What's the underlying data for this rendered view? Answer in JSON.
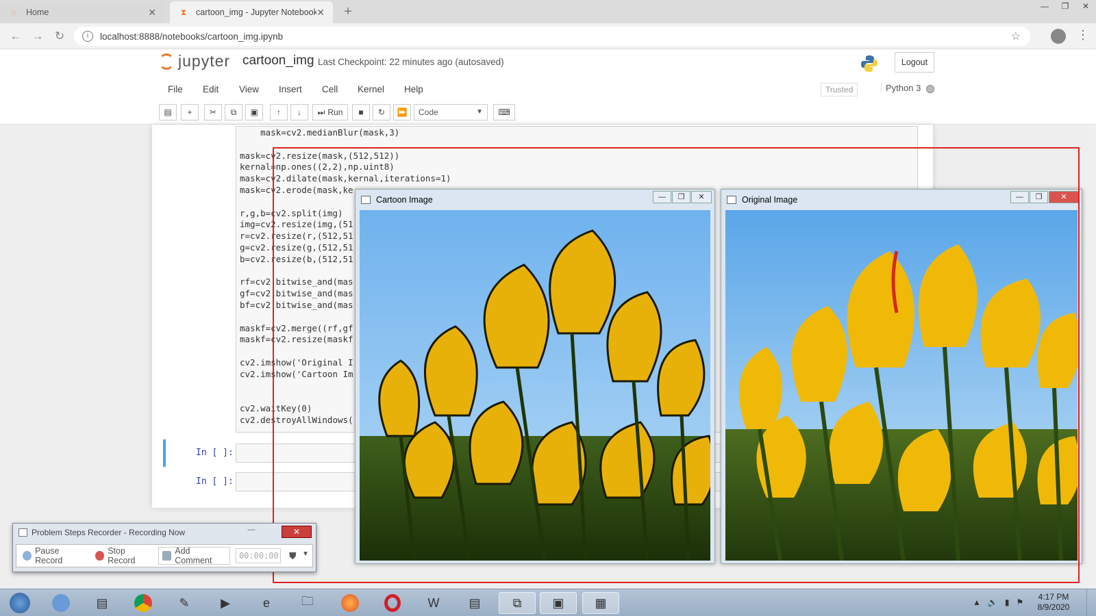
{
  "browser": {
    "tabs": [
      {
        "label": "Home",
        "active": false
      },
      {
        "label": "cartoon_img - Jupyter Notebook",
        "active": true
      }
    ],
    "url": "localhost:8888/notebooks/cartoon_img.ipynb"
  },
  "jupyter": {
    "logo_text": "jupyter",
    "notebook_name": "cartoon_img",
    "checkpoint": "Last Checkpoint: 22 minutes ago  (autosaved)",
    "logout_label": "Logout",
    "menu": [
      "File",
      "Edit",
      "View",
      "Insert",
      "Cell",
      "Kernel",
      "Help"
    ],
    "trusted_label": "Trusted",
    "kernel_name": "Python 3",
    "toolbar": {
      "run_label": "Run",
      "cell_type": "Code"
    }
  },
  "code_lines": [
    "    mask=cv2.medianBlur(mask,3)",
    "",
    "mask=cv2.resize(mask,(512,512))",
    "kernal=np.ones((2,2),np.uint8)",
    "mask=cv2.dilate(mask,kernal,iterations=1)",
    "mask=cv2.erode(mask,ke",
    "",
    "r,g,b=cv2.split(img)",
    "img=cv2.resize(img,(51",
    "r=cv2.resize(r,(512,51",
    "g=cv2.resize(g,(512,51",
    "b=cv2.resize(b,(512,51",
    "",
    "rf=cv2.bitwise_and(mas",
    "gf=cv2.bitwise_and(mas",
    "bf=cv2.bitwise_and(mas",
    "",
    "maskf=cv2.merge((rf,gf",
    "maskf=cv2.resize(maskf",
    "",
    "cv2.imshow('Original I",
    "cv2.imshow('Cartoon Im",
    "",
    "",
    "cv2.waitKey(0)",
    "cv2.destroyAllWindows("
  ],
  "cells": [
    {
      "prompt": "In [ ]:"
    },
    {
      "prompt": "In [ ]:"
    }
  ],
  "windows": {
    "cartoon_title": "Cartoon Image",
    "original_title": "Original Image"
  },
  "psr": {
    "title": "Problem Steps Recorder - Recording Now",
    "pause_label": "Pause Record",
    "stop_label": "Stop Record",
    "comment_label": "Add Comment",
    "timer": "00:00:00"
  },
  "taskbar": {
    "time": "4:17 PM",
    "date": "8/9/2020"
  },
  "colors": {
    "recording_border": "#e02020",
    "jupyter_orange": "#f37726",
    "tulip_yellow": "#f2b807"
  }
}
